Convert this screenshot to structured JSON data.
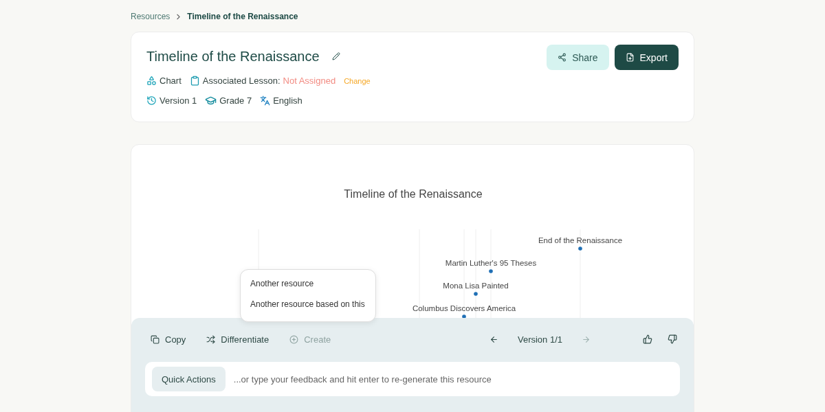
{
  "breadcrumb": [
    {
      "label": "Resources",
      "current": false
    },
    {
      "label": "Timeline of the Renaissance",
      "current": true
    }
  ],
  "header": {
    "title": "Timeline of the Renaissance",
    "meta": [
      {
        "kind": "type",
        "label": "Chart"
      },
      {
        "kind": "lesson",
        "label": "Associated Lesson:",
        "value": "Not Assigned",
        "action": "Change"
      }
    ],
    "details": [
      {
        "kind": "version",
        "label": "Version 1"
      },
      {
        "kind": "grade",
        "label": "Grade 7"
      },
      {
        "kind": "language",
        "label": "English"
      }
    ],
    "buttons": [
      {
        "kind": "share",
        "label": "Share"
      },
      {
        "kind": "export",
        "label": "Export"
      }
    ]
  },
  "chart": {
    "title": "Timeline of the Renaissance",
    "events": [
      {
        "label": "End of the Renaissance"
      },
      {
        "label": "Martin Luther's 95 Theses"
      },
      {
        "label": "Mona Lisa Painted"
      },
      {
        "label": "Columbus Discovers America"
      }
    ]
  },
  "menu": {
    "items": [
      "Another resource",
      "Another resource based on this"
    ]
  },
  "toolbar": {
    "actions": [
      {
        "kind": "copy",
        "label": "Copy",
        "disabled": false
      },
      {
        "kind": "differentiate",
        "label": "Differentiate",
        "disabled": false
      },
      {
        "kind": "create",
        "label": "Create",
        "disabled": true
      }
    ],
    "version": {
      "label": "Version 1/1",
      "prev_disabled": false,
      "next_disabled": true
    }
  },
  "feedback": {
    "button": "Quick Actions",
    "placeholder": "...or type your feedback and hit enter to re-generate this resource"
  }
}
